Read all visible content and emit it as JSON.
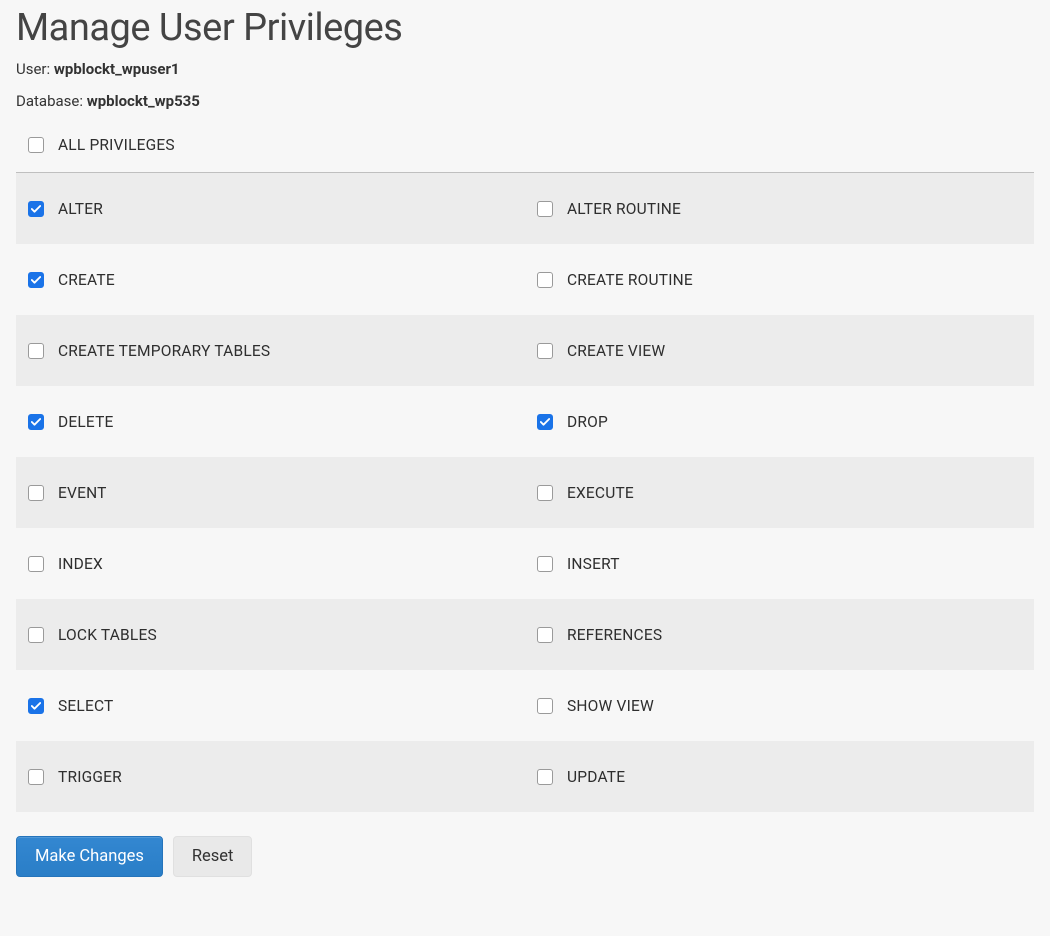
{
  "header": {
    "title": "Manage User Privileges",
    "user_label": "User:",
    "user_value": "wpblockt_wpuser1",
    "db_label": "Database:",
    "db_value": "wpblockt_wp535"
  },
  "all_privileges": {
    "label": "ALL PRIVILEGES",
    "checked": false
  },
  "privileges": [
    {
      "left": {
        "label": "ALTER",
        "checked": true
      },
      "right": {
        "label": "ALTER ROUTINE",
        "checked": false
      },
      "striped": true
    },
    {
      "left": {
        "label": "CREATE",
        "checked": true
      },
      "right": {
        "label": "CREATE ROUTINE",
        "checked": false
      },
      "striped": false
    },
    {
      "left": {
        "label": "CREATE TEMPORARY TABLES",
        "checked": false
      },
      "right": {
        "label": "CREATE VIEW",
        "checked": false
      },
      "striped": true
    },
    {
      "left": {
        "label": "DELETE",
        "checked": true
      },
      "right": {
        "label": "DROP",
        "checked": true
      },
      "striped": false
    },
    {
      "left": {
        "label": "EVENT",
        "checked": false
      },
      "right": {
        "label": "EXECUTE",
        "checked": false
      },
      "striped": true
    },
    {
      "left": {
        "label": "INDEX",
        "checked": false
      },
      "right": {
        "label": "INSERT",
        "checked": false
      },
      "striped": false
    },
    {
      "left": {
        "label": "LOCK TABLES",
        "checked": false
      },
      "right": {
        "label": "REFERENCES",
        "checked": false
      },
      "striped": true
    },
    {
      "left": {
        "label": "SELECT",
        "checked": true
      },
      "right": {
        "label": "SHOW VIEW",
        "checked": false
      },
      "striped": false
    },
    {
      "left": {
        "label": "TRIGGER",
        "checked": false
      },
      "right": {
        "label": "UPDATE",
        "checked": false
      },
      "striped": true
    }
  ],
  "actions": {
    "submit_label": "Make Changes",
    "reset_label": "Reset"
  }
}
